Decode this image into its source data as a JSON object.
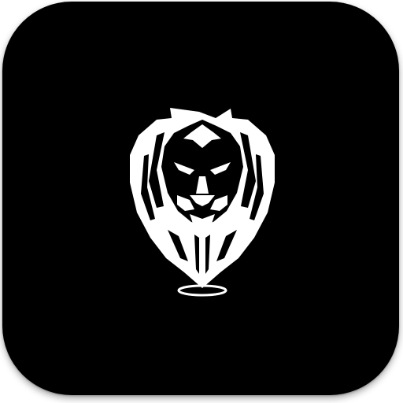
{
  "app_icon": {
    "name": "lion-location-pin-logo",
    "background_color": "#000000",
    "foreground_color": "#ffffff",
    "icon": "lion-head-map-pin-icon"
  }
}
